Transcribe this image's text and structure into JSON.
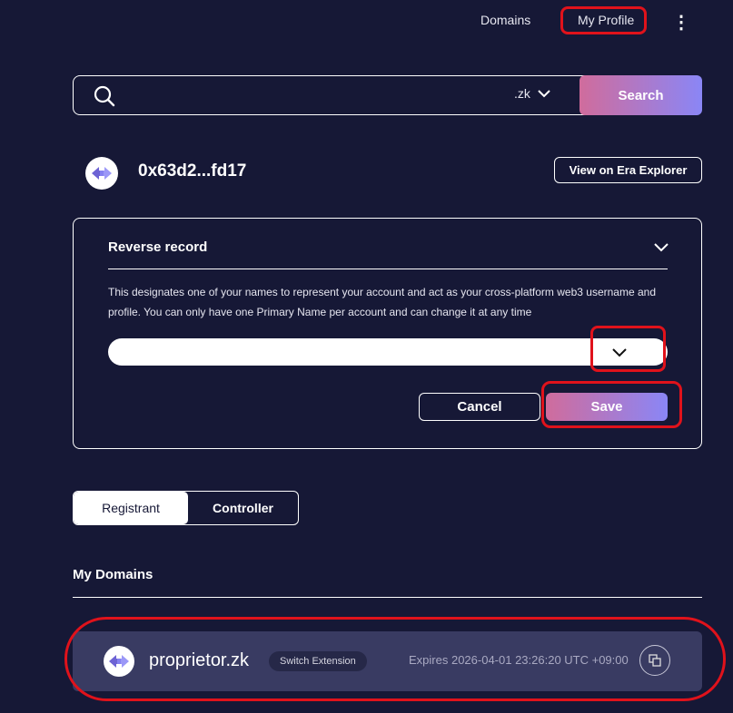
{
  "nav": {
    "domains_label": "Domains",
    "profile_label": "My Profile",
    "menu_glyph": "⋮"
  },
  "search": {
    "placeholder": "",
    "extension": ".zk",
    "button_label": "Search"
  },
  "account": {
    "address": "0x63d2...fd17",
    "explorer_button": "View on Era Explorer"
  },
  "reverse_record": {
    "title": "Reverse record",
    "description": "This designates one of your names to represent your account and act as your cross-platform web3 username and profile. You can only have one Primary Name per account and can change it at any time",
    "select_value": "",
    "cancel_label": "Cancel",
    "save_label": "Save"
  },
  "tabs": [
    {
      "label": "Registrant",
      "active": true
    },
    {
      "label": "Controller",
      "active": false
    }
  ],
  "my_domains": {
    "heading": "My Domains",
    "items": [
      {
        "name": "proprietor.zk",
        "badge": "Switch Extension",
        "expires": "Expires 2026-04-01 23:26:20 UTC +09:00"
      }
    ]
  },
  "colors": {
    "background": "#161836",
    "accent_start": "#d06c9c",
    "accent_end": "#8a86f6",
    "card": "#393b62",
    "annotation": "#e0121b"
  },
  "icons": [
    "search-icon",
    "chevron-down-icon",
    "more-vertical-icon",
    "swap-arrows-icon",
    "copy-icon"
  ]
}
